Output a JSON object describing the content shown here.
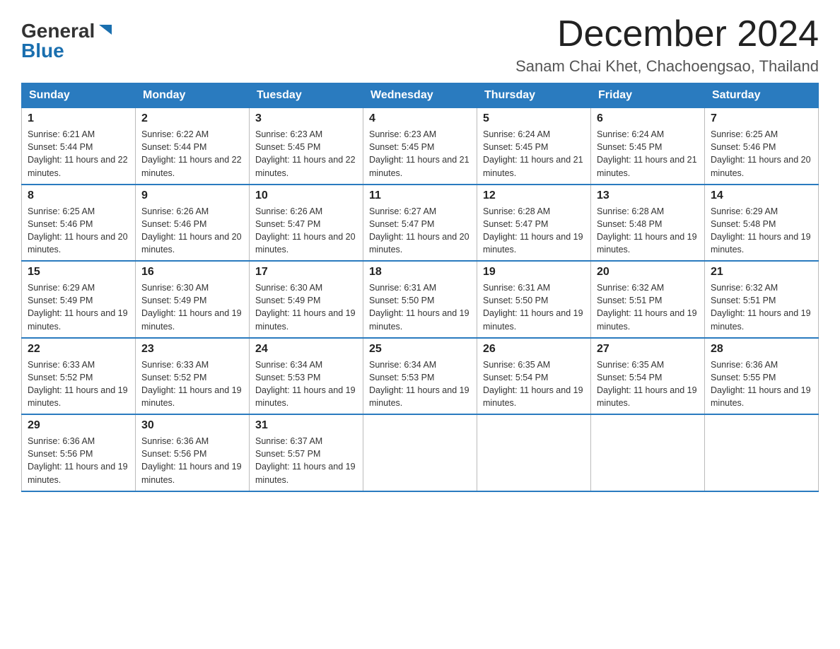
{
  "logo": {
    "general": "General",
    "blue": "Blue"
  },
  "header": {
    "month": "December 2024",
    "location": "Sanam Chai Khet, Chachoengsao, Thailand"
  },
  "weekdays": [
    "Sunday",
    "Monday",
    "Tuesday",
    "Wednesday",
    "Thursday",
    "Friday",
    "Saturday"
  ],
  "weeks": [
    [
      {
        "day": "1",
        "sunrise": "6:21 AM",
        "sunset": "5:44 PM",
        "daylight": "11 hours and 22 minutes."
      },
      {
        "day": "2",
        "sunrise": "6:22 AM",
        "sunset": "5:44 PM",
        "daylight": "11 hours and 22 minutes."
      },
      {
        "day": "3",
        "sunrise": "6:23 AM",
        "sunset": "5:45 PM",
        "daylight": "11 hours and 22 minutes."
      },
      {
        "day": "4",
        "sunrise": "6:23 AM",
        "sunset": "5:45 PM",
        "daylight": "11 hours and 21 minutes."
      },
      {
        "day": "5",
        "sunrise": "6:24 AM",
        "sunset": "5:45 PM",
        "daylight": "11 hours and 21 minutes."
      },
      {
        "day": "6",
        "sunrise": "6:24 AM",
        "sunset": "5:45 PM",
        "daylight": "11 hours and 21 minutes."
      },
      {
        "day": "7",
        "sunrise": "6:25 AM",
        "sunset": "5:46 PM",
        "daylight": "11 hours and 20 minutes."
      }
    ],
    [
      {
        "day": "8",
        "sunrise": "6:25 AM",
        "sunset": "5:46 PM",
        "daylight": "11 hours and 20 minutes."
      },
      {
        "day": "9",
        "sunrise": "6:26 AM",
        "sunset": "5:46 PM",
        "daylight": "11 hours and 20 minutes."
      },
      {
        "day": "10",
        "sunrise": "6:26 AM",
        "sunset": "5:47 PM",
        "daylight": "11 hours and 20 minutes."
      },
      {
        "day": "11",
        "sunrise": "6:27 AM",
        "sunset": "5:47 PM",
        "daylight": "11 hours and 20 minutes."
      },
      {
        "day": "12",
        "sunrise": "6:28 AM",
        "sunset": "5:47 PM",
        "daylight": "11 hours and 19 minutes."
      },
      {
        "day": "13",
        "sunrise": "6:28 AM",
        "sunset": "5:48 PM",
        "daylight": "11 hours and 19 minutes."
      },
      {
        "day": "14",
        "sunrise": "6:29 AM",
        "sunset": "5:48 PM",
        "daylight": "11 hours and 19 minutes."
      }
    ],
    [
      {
        "day": "15",
        "sunrise": "6:29 AM",
        "sunset": "5:49 PM",
        "daylight": "11 hours and 19 minutes."
      },
      {
        "day": "16",
        "sunrise": "6:30 AM",
        "sunset": "5:49 PM",
        "daylight": "11 hours and 19 minutes."
      },
      {
        "day": "17",
        "sunrise": "6:30 AM",
        "sunset": "5:49 PM",
        "daylight": "11 hours and 19 minutes."
      },
      {
        "day": "18",
        "sunrise": "6:31 AM",
        "sunset": "5:50 PM",
        "daylight": "11 hours and 19 minutes."
      },
      {
        "day": "19",
        "sunrise": "6:31 AM",
        "sunset": "5:50 PM",
        "daylight": "11 hours and 19 minutes."
      },
      {
        "day": "20",
        "sunrise": "6:32 AM",
        "sunset": "5:51 PM",
        "daylight": "11 hours and 19 minutes."
      },
      {
        "day": "21",
        "sunrise": "6:32 AM",
        "sunset": "5:51 PM",
        "daylight": "11 hours and 19 minutes."
      }
    ],
    [
      {
        "day": "22",
        "sunrise": "6:33 AM",
        "sunset": "5:52 PM",
        "daylight": "11 hours and 19 minutes."
      },
      {
        "day": "23",
        "sunrise": "6:33 AM",
        "sunset": "5:52 PM",
        "daylight": "11 hours and 19 minutes."
      },
      {
        "day": "24",
        "sunrise": "6:34 AM",
        "sunset": "5:53 PM",
        "daylight": "11 hours and 19 minutes."
      },
      {
        "day": "25",
        "sunrise": "6:34 AM",
        "sunset": "5:53 PM",
        "daylight": "11 hours and 19 minutes."
      },
      {
        "day": "26",
        "sunrise": "6:35 AM",
        "sunset": "5:54 PM",
        "daylight": "11 hours and 19 minutes."
      },
      {
        "day": "27",
        "sunrise": "6:35 AM",
        "sunset": "5:54 PM",
        "daylight": "11 hours and 19 minutes."
      },
      {
        "day": "28",
        "sunrise": "6:36 AM",
        "sunset": "5:55 PM",
        "daylight": "11 hours and 19 minutes."
      }
    ],
    [
      {
        "day": "29",
        "sunrise": "6:36 AM",
        "sunset": "5:56 PM",
        "daylight": "11 hours and 19 minutes."
      },
      {
        "day": "30",
        "sunrise": "6:36 AM",
        "sunset": "5:56 PM",
        "daylight": "11 hours and 19 minutes."
      },
      {
        "day": "31",
        "sunrise": "6:37 AM",
        "sunset": "5:57 PM",
        "daylight": "11 hours and 19 minutes."
      },
      null,
      null,
      null,
      null
    ]
  ]
}
